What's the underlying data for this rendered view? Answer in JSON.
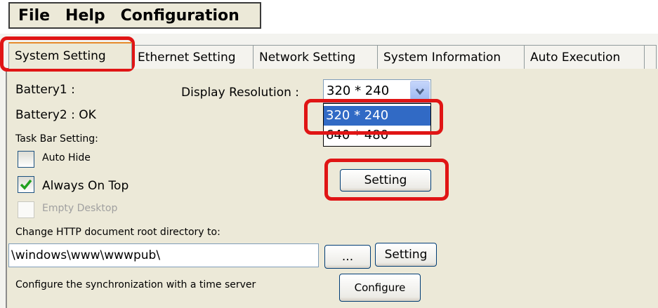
{
  "menu": {
    "items": [
      "File",
      "Help",
      "Configuration"
    ]
  },
  "tabs": [
    "System Setting",
    "Ethernet Setting",
    "Network Setting",
    "System Information",
    "Auto Execution"
  ],
  "system_setting": {
    "battery1_label": "Battery1 :",
    "battery2_label": "Battery2 : OK",
    "display_resolution_label": "Display Resolution :",
    "resolution_selected": "320 * 240",
    "resolution_options": [
      "320 * 240",
      "640 * 480"
    ],
    "taskbar_label": "Task Bar Setting:",
    "auto_hide_label": "Auto Hide",
    "auto_hide_checked": false,
    "always_on_top_label": "Always On Top",
    "always_on_top_checked": true,
    "empty_desktop_label": "Empty Desktop",
    "empty_desktop_enabled": false,
    "setting_button": "Setting",
    "http_root_label": "Change HTTP document root directory to:",
    "http_root_value": "\\windows\\www\\wwwpub\\",
    "browse_button": "...",
    "http_setting_button": "Setting",
    "time_sync_label": "Configure the synchronization with a time server",
    "configure_button": "Configure"
  },
  "highlight_color": "#e01515",
  "selection_color": "#316ac5",
  "check_color": "#21a121"
}
